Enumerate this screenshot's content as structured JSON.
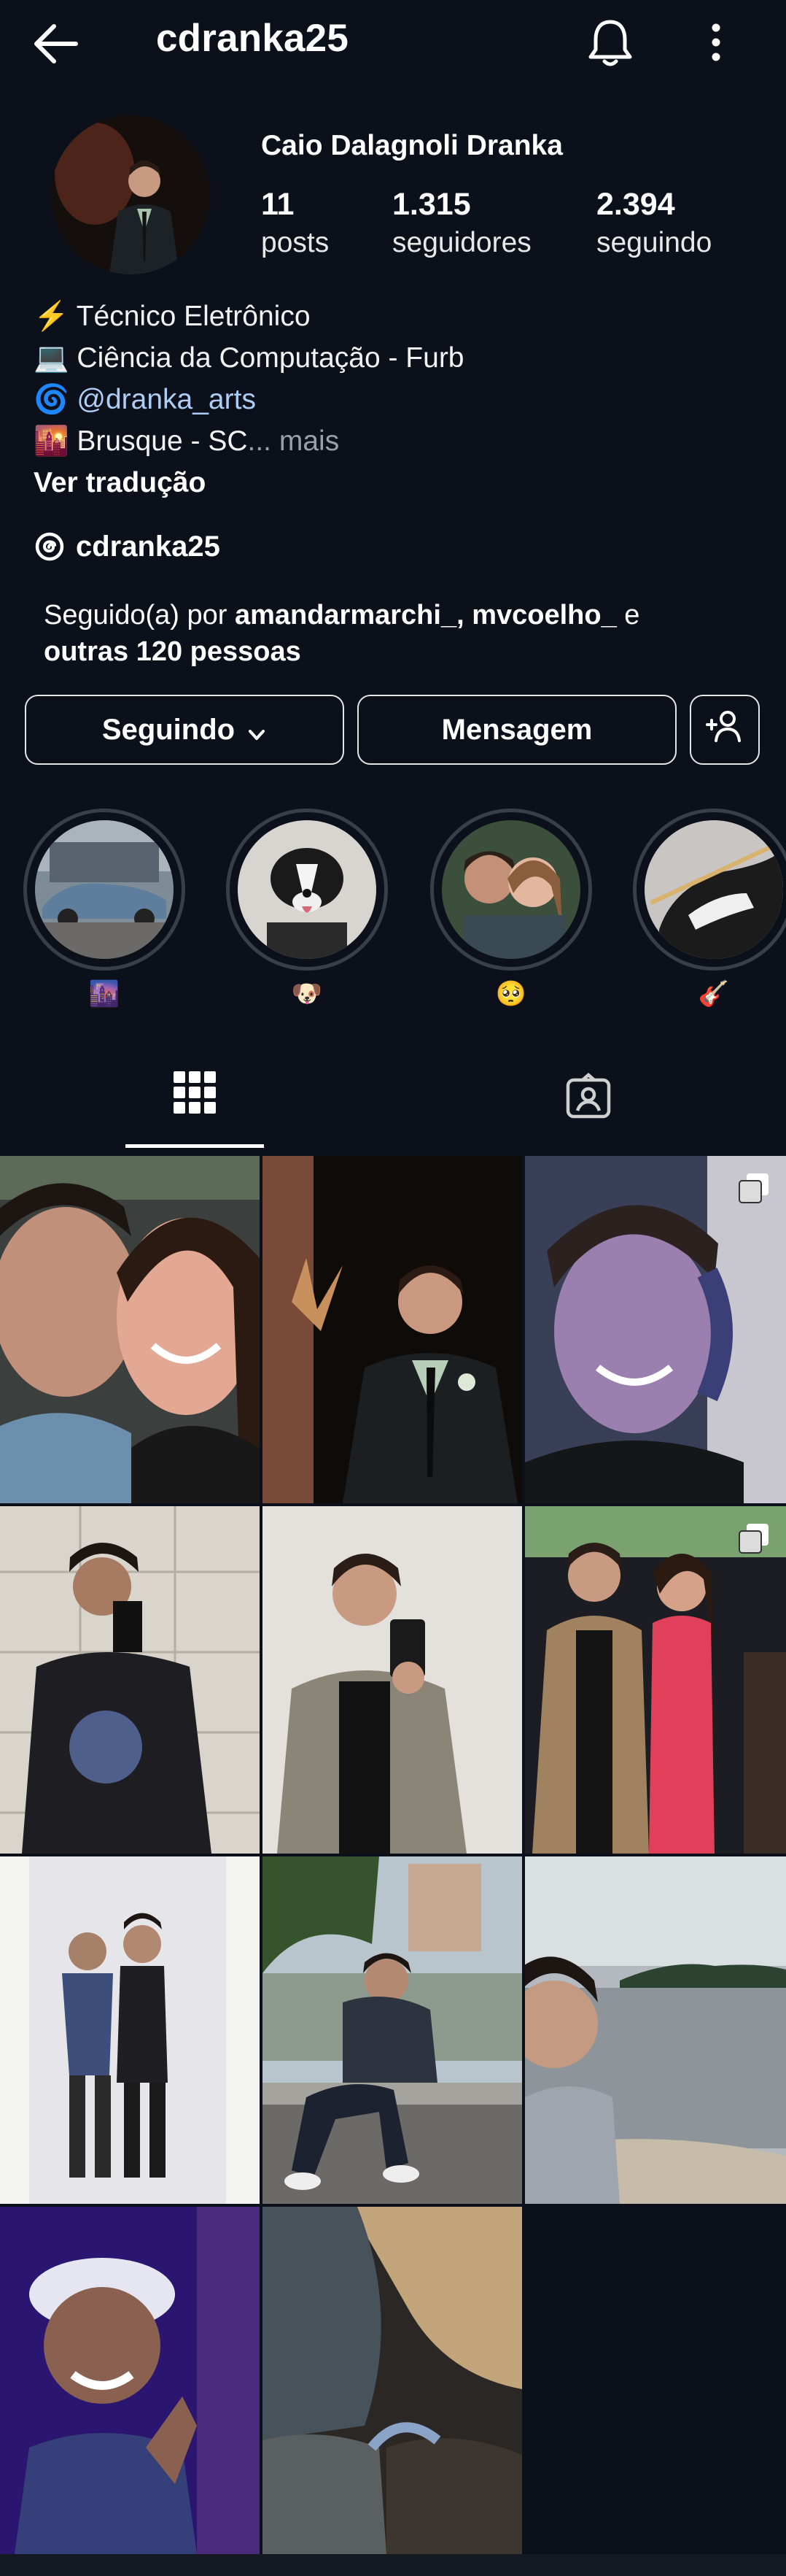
{
  "header": {
    "username": "cdranka25",
    "icons": {
      "back": "arrow-left-icon",
      "notifications": "bell-icon",
      "more": "more-vertical-icon"
    }
  },
  "profile": {
    "full_name": "Caio Dalagnoli Dranka",
    "stats": [
      {
        "value": "11",
        "label": "posts"
      },
      {
        "value": "1.315",
        "label": "seguidores"
      },
      {
        "value": "2.394",
        "label": "seguindo"
      }
    ],
    "bio": [
      {
        "emoji": "⚡",
        "text": "Técnico Eletrônico"
      },
      {
        "emoji": "💻",
        "text": "Ciência da Computação - Furb"
      },
      {
        "emoji": "🌀",
        "text": "@dranka_arts"
      },
      {
        "emoji": "🌇",
        "text": "Brusque - SC",
        "more": "... mais"
      }
    ],
    "translate": "Ver tradução",
    "threads_handle": "cdranka25",
    "followed_by_prefix": "Seguido(a) por ",
    "followed_by_names": "amandarmarchi_, mvcoelho_",
    "followed_by_and": " e",
    "followed_by_others": "outras 120 pessoas"
  },
  "actions": {
    "following": "Seguindo",
    "message": "Mensagem",
    "add_person_icon": "add-person-icon"
  },
  "highlights": [
    {
      "label": "🌆"
    },
    {
      "label": "🐶"
    },
    {
      "label": "🥺"
    },
    {
      "label": "🎸"
    }
  ],
  "tabs": {
    "grid_icon": "grid-icon",
    "tagged_icon": "tagged-icon"
  },
  "colors": {
    "background": "#0b101a",
    "link": "#aecdf5",
    "muted": "#9aa0a8"
  }
}
